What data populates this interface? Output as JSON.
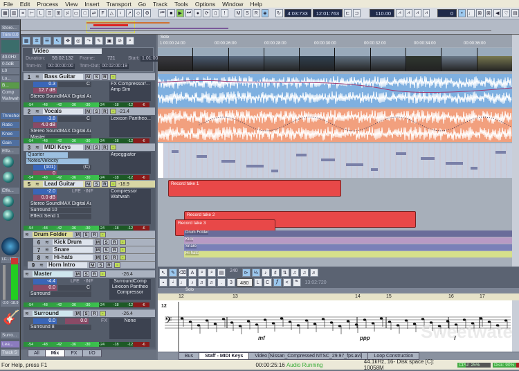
{
  "menu": [
    "File",
    "Edit",
    "Process",
    "View",
    "Insert",
    "Transport",
    "Go",
    "Track",
    "Tools",
    "Options",
    "Window",
    "Help"
  ],
  "transport": {
    "now_time": "4:03:733",
    "end_time": "12:01:763",
    "tempo": "110.00",
    "metronome": "0",
    "m": "M",
    "s": "S",
    "r": "R"
  },
  "inspector": {
    "trim_label": "Trim",
    "trim_value": "0.0",
    "store": "Store...",
    "freq": "40.0Hz",
    "gain": "0.0dB",
    "pan": "L0",
    "lo": "Lo...",
    "band": "B...",
    "fx1": "Comp",
    "fx2": "Wahwah",
    "params": [
      "Threshold",
      "Ratio",
      "Knee",
      "Gain"
    ],
    "effects": "Effe...",
    "levels": "-2.0  -18.9",
    "lfe": "LF...  INF",
    "output": "Surro...",
    "track_name": "Lea...",
    "track_num": "Track 5"
  },
  "video": {
    "title": "Video",
    "duration_label": "Duration:",
    "duration": "56:02:132",
    "frame_label": "Frame:",
    "frame": "721",
    "start_label": "Start:",
    "start": "1:01:000",
    "trimin_label": "Trim-In:",
    "trimin": "00:00:00:00",
    "trimout_label": "Trim-Out:",
    "trimout": "00:02:00:19"
  },
  "tracks": [
    {
      "num": "1",
      "name": "Bass Guitar",
      "vol": "0.3",
      "pan": "12.7 dB",
      "panlr": "C",
      "out": "Stereo SoundMAX Digital Au",
      "fx": [
        "FX Compressor/...",
        "Amp Sim"
      ]
    },
    {
      "num": "2",
      "name": "Vocals",
      "vol": "-3.8",
      "pan": "4.0 dB",
      "panlr": "C",
      "out": "Stereo SoundMAX Digital Au",
      "send": "Master",
      "peak": "-21.4",
      "fx": [
        "Lexicon Pantheo..."
      ]
    },
    {
      "num": "3",
      "name": "MIDI Keys",
      "quant": "Quarter",
      "mode": "Notes/Velocity",
      "vol": "(101)",
      "pan": "0",
      "panlr": "(C)",
      "fx": [
        "Arpeggiator"
      ]
    },
    {
      "num": "5",
      "name": "Lead Guitar",
      "vol": "-2.0",
      "pan": "0.0 dB",
      "lfe": "LFE",
      "inf": "-INF",
      "out": "Stereo SoundMAX Digital Au",
      "surround": "Surround 10",
      "send": "Effect Send 1",
      "peak": "-18.9",
      "fx": [
        "Compressor",
        "Wahwah"
      ]
    }
  ],
  "meter_ticks": [
    "-54",
    "-48",
    "-42",
    "-36",
    "-30",
    "-24",
    "-18",
    "-12",
    "-6"
  ],
  "drum_folder": {
    "name": "Drum Folder",
    "children": [
      {
        "num": "6",
        "name": "Kick Drum"
      },
      {
        "num": "7",
        "name": "Snare"
      },
      {
        "num": "8",
        "name": "Hi-hats"
      },
      {
        "num": "9",
        "name": "Horn Intro"
      }
    ]
  },
  "buses": [
    {
      "name": "Master",
      "vol": "-4.4",
      "lfe": "LFE",
      "inf": "-INF",
      "pan": "0.0",
      "panlr": "C",
      "out": "Surround",
      "peak": "-26.4",
      "fx": [
        "SurroundComp",
        "Lexicon Pantheo",
        "Compressor"
      ]
    },
    {
      "name": "Surround",
      "vol": "0.0",
      "pan": "0.0",
      "out": "Surround 8",
      "peak": "-26.4",
      "fx_label": "FX",
      "fx": [
        "None"
      ]
    }
  ],
  "mix_tabs": [
    "All",
    "Mix",
    "FX",
    "I/O"
  ],
  "ruler": {
    "marker": "Solo",
    "start": "1:00:00:24:00",
    "times": [
      "00:00:26:00",
      "00:00:28:00",
      "00:00:30:00",
      "00:00:32:00",
      "00:00:34:00",
      "00:00:36:00"
    ]
  },
  "clips": {
    "takes": [
      "Record take 1",
      "Record take 2",
      "Record take 3"
    ],
    "lanes": [
      "Drum Folder",
      "Kick",
      "Snare",
      "Hi-hats"
    ]
  },
  "staff": {
    "res1": "240",
    "res2": "480",
    "time": "13:02:720",
    "marker": "Solo",
    "measures": [
      "12",
      "13",
      "14",
      "15",
      "16",
      "17"
    ],
    "row_label": "12",
    "dynamics": [
      "mf",
      "ppp",
      "f"
    ]
  },
  "view_tabs": [
    "Bus",
    "Staff - MIDI Keys",
    "Video [Nissan_Compressed NTSC_29.97_fps.avi]",
    "Loop Construction"
  ],
  "status": {
    "help": "For Help, press F1",
    "time": "00:00:25:16",
    "audio": "Audio Running",
    "format": "44.1kHz, 16- Disk space [C]: 10058M",
    "cpu": "CPU: 25%",
    "disk": "Disk: 90%"
  },
  "watermark": "Sweetwater"
}
